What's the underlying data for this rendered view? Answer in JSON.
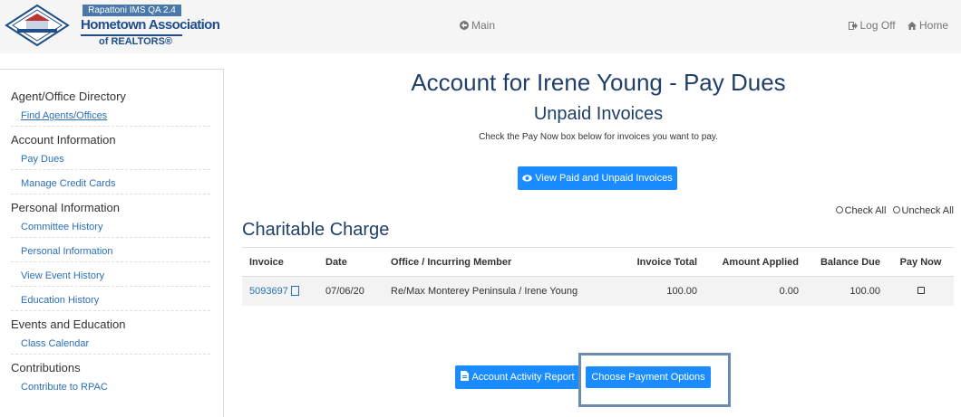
{
  "header": {
    "logo_tag": "Rapattoni IMS QA 2.4",
    "logo_line1": "Hometown Association",
    "logo_line2": "of REALTORS®",
    "main_label": "Main",
    "logoff_label": "Log Off",
    "home_label": "Home"
  },
  "sidebar": {
    "sections": [
      {
        "heading": "Agent/Office Directory",
        "links": [
          "Find Agents/Offices"
        ]
      },
      {
        "heading": "Account Information",
        "links": [
          "Pay Dues",
          "Manage Credit Cards"
        ]
      },
      {
        "heading": "Personal Information",
        "links": [
          "Committee History",
          "Personal Information",
          "View Event History",
          "Education History"
        ]
      },
      {
        "heading": "Events and Education",
        "links": [
          "Class Calendar"
        ]
      },
      {
        "heading": "Contributions",
        "links": [
          "Contribute to RPAC"
        ]
      }
    ]
  },
  "main": {
    "title": "Account for Irene Young - Pay Dues",
    "subtitle": "Unpaid Invoices",
    "instruction": "Check the Pay Now box below for invoices you want to pay.",
    "view_button": "View Paid and Unpaid Invoices",
    "check_all": "Check All",
    "uncheck_all": "Uncheck All",
    "section_title": "Charitable Charge",
    "table": {
      "headers": [
        "Invoice",
        "Date",
        "Office / Incurring Member",
        "Invoice Total",
        "Amount Applied",
        "Balance Due",
        "Pay Now"
      ],
      "rows": [
        {
          "invoice": "5093697",
          "date": "07/06/20",
          "office": "Re/Max Monterey Peninsula / Irene Young",
          "total": "100.00",
          "applied": "0.00",
          "balance": "100.00"
        }
      ]
    },
    "report_button": "Account Activity Report",
    "choose_button": "Choose Payment Options"
  },
  "colors": {
    "primary_button": "#1a8cff",
    "link": "#2a6fb8",
    "heading": "#1f3f6a",
    "highlight_border": "#6b8cae"
  }
}
